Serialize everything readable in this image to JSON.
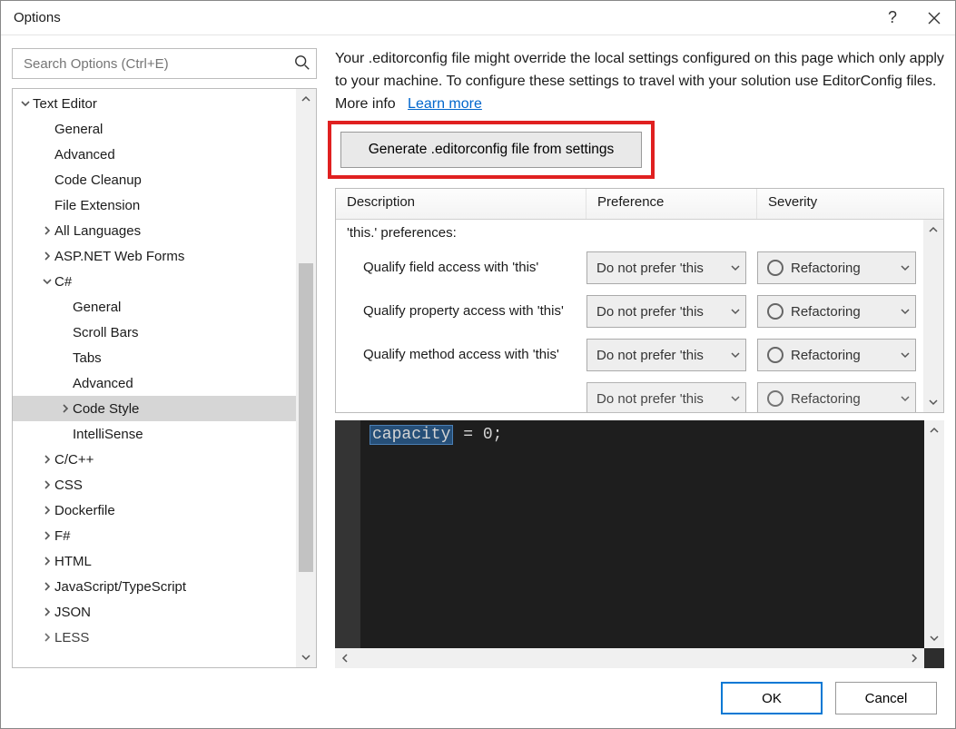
{
  "titlebar": {
    "title": "Options"
  },
  "search": {
    "placeholder": "Search Options (Ctrl+E)"
  },
  "tree": {
    "root": {
      "label": "Text Editor"
    },
    "items": [
      {
        "label": "General"
      },
      {
        "label": "Advanced"
      },
      {
        "label": "Code Cleanup"
      },
      {
        "label": "File Extension"
      },
      {
        "label": "All Languages"
      },
      {
        "label": "ASP.NET Web Forms"
      },
      {
        "label": "C#"
      },
      {
        "label": "General"
      },
      {
        "label": "Scroll Bars"
      },
      {
        "label": "Tabs"
      },
      {
        "label": "Advanced"
      },
      {
        "label": "Code Style"
      },
      {
        "label": "IntelliSense"
      },
      {
        "label": "C/C++"
      },
      {
        "label": "CSS"
      },
      {
        "label": "Dockerfile"
      },
      {
        "label": "F#"
      },
      {
        "label": "HTML"
      },
      {
        "label": "JavaScript/TypeScript"
      },
      {
        "label": "JSON"
      },
      {
        "label": "LESS"
      }
    ]
  },
  "info": {
    "text_a": "Your .editorconfig file might override the local settings configured on this page which only apply to your machine. To configure these settings to travel with your solution use EditorConfig files. More info",
    "link": "Learn more"
  },
  "generate_button": "Generate .editorconfig file from settings",
  "columns": {
    "desc": "Description",
    "pref": "Preference",
    "sev": "Severity"
  },
  "group": "'this.' preferences:",
  "rows": [
    {
      "desc": "Qualify field access with 'this'",
      "pref": "Do not prefer 'this",
      "sev": "Refactoring"
    },
    {
      "desc": "Qualify property access with 'this'",
      "pref": "Do not prefer 'this",
      "sev": "Refactoring"
    },
    {
      "desc": "Qualify method access with 'this'",
      "pref": "Do not prefer 'this",
      "sev": "Refactoring"
    },
    {
      "desc": "",
      "pref": "Do not prefer 'this",
      "sev": "Refactoring"
    }
  ],
  "code": {
    "token_sel": "capacity",
    "rest": " = 0;"
  },
  "footer": {
    "ok": "OK",
    "cancel": "Cancel"
  }
}
